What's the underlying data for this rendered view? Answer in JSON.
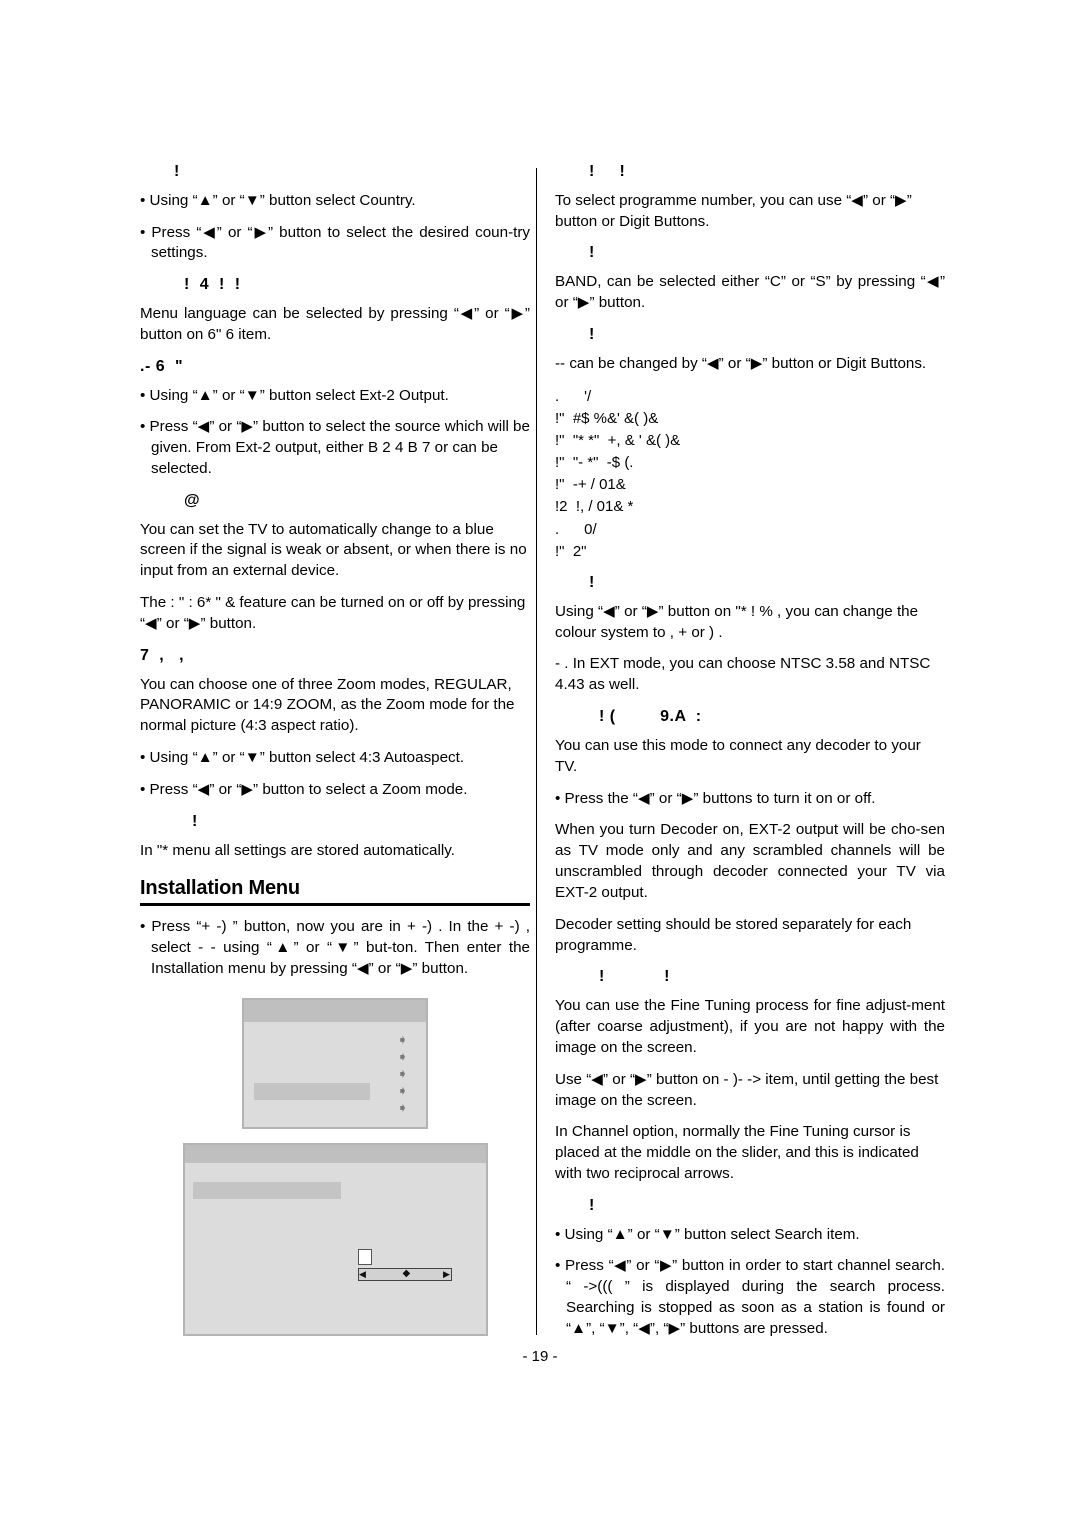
{
  "page": {
    "number_label": "- 19 -"
  },
  "left_column": {
    "heading_country": "!",
    "country_bullet_1": "• Using “▲” or “▼” button select Country.",
    "country_bullet_2": "• Press “◀” or “▶” button to  select the desired coun-try settings.",
    "heading_language": "!  4  !  !",
    "language_text": "Menu language can be selected by pressing “◀” or “▶” button on    6\" 6          item.",
    "heading_ext2": ".- 6  \"",
    "ext2_bullet_1": "• Using “▲” or “▼” button select Ext-2 Output.",
    "ext2_bullet_2": "• Press “◀” or “▶” button to select the source which will be given. From Ext-2 output, either  B  2  4  B 7   or     can be selected.",
    "heading_bluescreen": "@",
    "bluescreen_text_1": "You can set the TV to automatically change to a blue screen if the signal is weak or absent, or when there is no input from an external device.",
    "bluescreen_text_2": "The : \"  :   6* \" &              feature can be turned on or off by pressing “◀” or “▶” button.",
    "heading_autoaspect": "7  ,   ,",
    "autoaspect_text": "You can choose one of three Zoom modes, REGULAR, PANORAMIC or 14:9 ZOOM, as the Zoom mode for the normal picture (4:3 aspect ratio).",
    "autoaspect_bullet_1": "• Using “▲” or “▼” button select 4:3 Autoaspect.",
    "autoaspect_bullet_2": "• Press “◀” or “▶” button to  select a Zoom mode.",
    "heading_store": "!",
    "store_text": "In    \"*        menu all settings are stored automatically.",
    "section_heading": "Installation Menu",
    "install_bullet_1": "• Press “+ -)      ” button, now you are in + -)     . In the + -)      , select  -                  -      using “▲” or “▼” but-ton. Then enter the Installation menu by pressing “◀” or “▶” button."
  },
  "right_column": {
    "heading_programme": "!     !",
    "programme_text": "To select programme number, you can use “◀” or “▶” button or Digit Buttons.",
    "heading_band": "!",
    "band_text": "BAND, can be selected either “C” or “S” by pressing “◀” or “▶” button.",
    "heading_channel": "!",
    "channel_text": "   --            can be changed by “◀” or “▶” button or Digit Buttons.",
    "garbled_block": ".      '/\n!\"  #$ %&' &( )&\n!\"  \"* *\"  +, & ' &( )&\n!\"  \"- *\"  -$ (.\n!\"  -+ / 01&\n!2  !, / 01& *\n.      0/\n!\"  2\"",
    "heading_colour": "!",
    "colour_text_1": "Using “◀” or “▶” button on      \"*  !  %          , you can change the colour system to ,        +           or )       .",
    "colour_text_2": "-   .    In EXT mode, you can choose NTSC 3.58 and NTSC 4.43 as well.",
    "heading_decoder": "! (         9.A  :",
    "decoder_text_1": "You can use this mode to connect any decoder to your TV.",
    "decoder_bullet_1": "• Press the “◀” or “▶” buttons to turn it on or off.",
    "decoder_text_2": "When you turn Decoder on, EXT-2 output will be cho-sen as TV mode only and any scrambled channels will be unscrambled through decoder connected your TV via EXT-2 output.",
    "decoder_text_3": "Decoder setting should be stored separately for each programme.",
    "heading_finetune": "!            !",
    "finetune_text_1": "You can use the Fine Tuning process for fine adjust-ment (after coarse adjustment), if you are not happy with the image on the screen.",
    "finetune_text_2": "Use “◀” or “▶” button on   -   )- ->            item, until getting the best image on the screen.",
    "finetune_text_3": "In Channel option, normally the Fine Tuning cursor is placed at the middle on the slider, and this is indicated with two reciprocal arrows.",
    "heading_search": "!",
    "search_bullet_1": "• Using “▲” or “▼” button select Search  item.",
    "search_bullet_2": "• Press “◀” or “▶” button in order to start channel search. “        ->(((            ” is displayed during the search process. Searching is stopped as soon as a station is found or “▲”, “▼”, “◀”, “▶” buttons are pressed."
  },
  "osd_menu_1": {
    "arrow_glyphs": [
      "➧",
      "➧",
      "➧",
      "➧",
      "➧"
    ]
  },
  "osd_menu_2": {
    "slider_left_cap": "◀",
    "slider_knob": "◆",
    "slider_right_cap": "▶"
  }
}
